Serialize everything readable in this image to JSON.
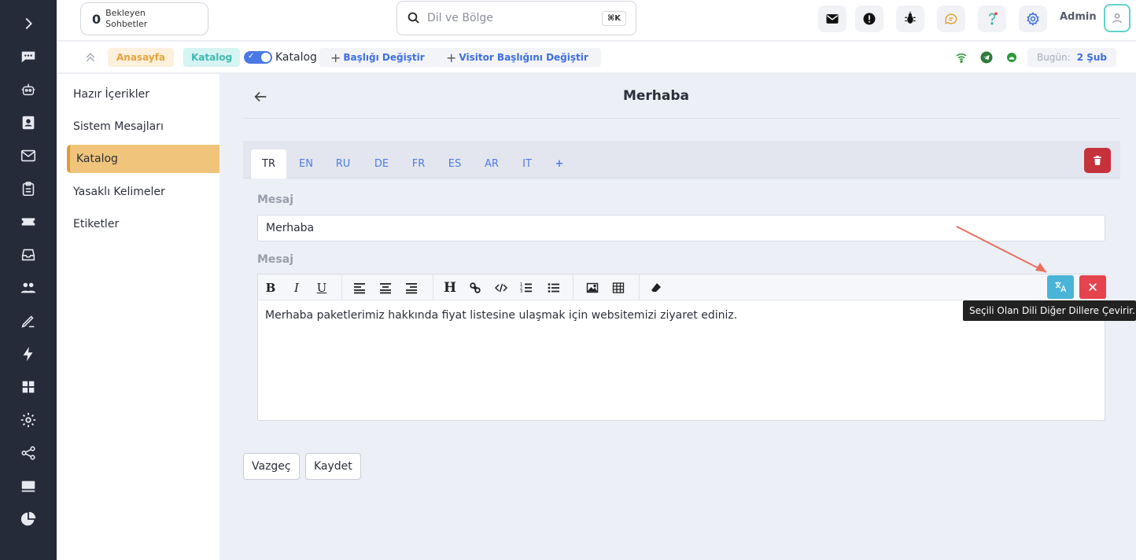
{
  "header": {
    "pending_count": "0",
    "pending_label_1": "Bekleyen",
    "pending_label_2": "Sohbetler",
    "search_placeholder": "Dil ve Bölge",
    "search_shortcut": "⌘K",
    "user_name": "Admin"
  },
  "breadcrumb": {
    "home": "Anasayfa",
    "catalog_badge": "Katalog",
    "toggle_label": "Katalog",
    "change_title": "Başlığı Değiştir",
    "change_visitor_title": "Visitor Başlığını Değiştir",
    "today_label": "Bugün:",
    "today_value": "2 Şub"
  },
  "submenu": {
    "items": [
      {
        "label": "Hazır İçerikler"
      },
      {
        "label": "Sistem Mesajları"
      },
      {
        "label": "Katalog"
      },
      {
        "label": "Yasaklı Kelimeler"
      },
      {
        "label": "Etiketler"
      }
    ],
    "active_index": 2
  },
  "page": {
    "title": "Merhaba"
  },
  "tabs": [
    "TR",
    "EN",
    "RU",
    "DE",
    "FR",
    "ES",
    "AR",
    "IT",
    "+"
  ],
  "form": {
    "title_label": "Mesaj",
    "title_value": "Merhaba",
    "message_label": "Mesaj",
    "message_value": "Merhaba paketlerimiz hakkında fiyat listesine ulaşmak için  websitemizi ziyaret ediniz.",
    "translate_tooltip": "Seçili Olan Dili Diğer Dillere Çevirir."
  },
  "actions": {
    "cancel": "Vazgeç",
    "save": "Kaydet"
  },
  "colors": {
    "rail_bg": "#262b3a",
    "active_menu": "#f0c57b",
    "link_blue": "#3d6fe0",
    "delete_red": "#c5323c",
    "translate_blue": "#4ab4d8",
    "arrow_red": "#e8705c"
  }
}
